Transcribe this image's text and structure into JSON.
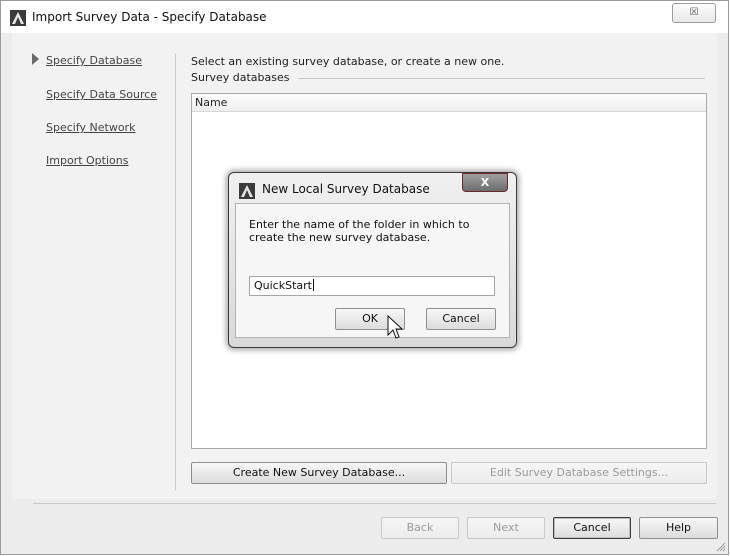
{
  "window": {
    "title": "Import Survey Data - Specify Database",
    "close_symbol": "☒"
  },
  "nav": {
    "items": [
      {
        "label": "Specify Database",
        "current": true
      },
      {
        "label": "Specify Data Source",
        "current": false
      },
      {
        "label": "Specify Network",
        "current": false
      },
      {
        "label": "Import Options",
        "current": false
      }
    ]
  },
  "main": {
    "instruction": "Select an existing survey database, or create a new one.",
    "group_label": "Survey databases",
    "list": {
      "columns": [
        "Name"
      ],
      "rows": []
    },
    "create_button": "Create New Survey Database...",
    "edit_button": "Edit Survey Database Settings..."
  },
  "footer": {
    "back": "Back",
    "next": "Next",
    "cancel": "Cancel",
    "help": "Help"
  },
  "dialog": {
    "title": "New Local Survey Database",
    "close_symbol": "X",
    "prompt": "Enter the name of the folder in which to create the new survey database.",
    "input_value": "QuickStart",
    "ok": "OK",
    "cancel": "Cancel"
  },
  "icons": {
    "app": "autodesk-civil3d-icon",
    "cursor": "mouse-pointer-icon"
  }
}
